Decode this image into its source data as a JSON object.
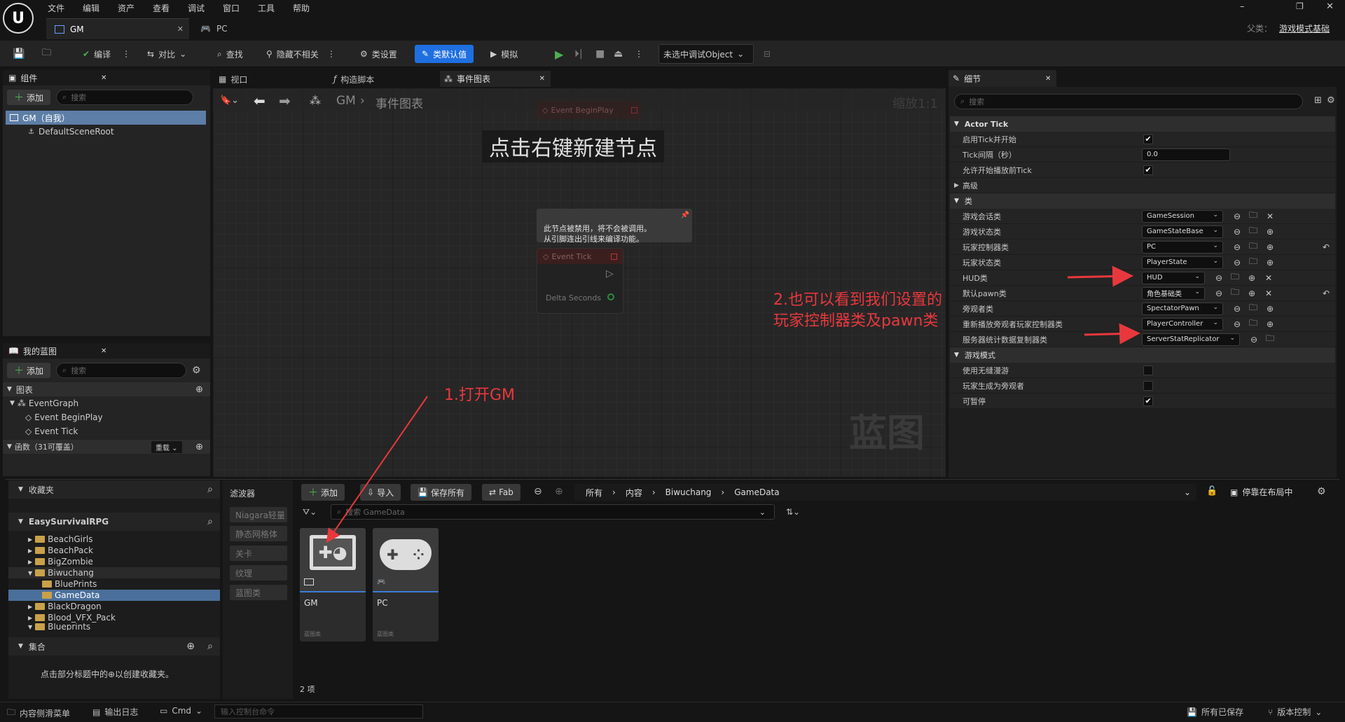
{
  "menu": [
    "文件",
    "编辑",
    "资产",
    "查看",
    "调试",
    "窗口",
    "工具",
    "帮助"
  ],
  "window_controls": {
    "minimize": "–",
    "restore": "❐",
    "close": "✕"
  },
  "tabs": [
    {
      "label": "GM",
      "active": true
    },
    {
      "label": "PC",
      "active": false
    }
  ],
  "parent_class": {
    "label": "父类：",
    "value": "游戏模式基础"
  },
  "toolbar": {
    "compile": "编译",
    "diff": "对比",
    "find": "查找",
    "hide_unrelated": "隐藏不相关",
    "class_settings": "类设置",
    "class_defaults": "类默认值",
    "simulate": "模拟",
    "debug_object": "未选中调试Object"
  },
  "components": {
    "title": "组件",
    "add": "添加",
    "search_placeholder": "搜索",
    "items": [
      {
        "label": "GM（自我）"
      },
      {
        "label": "DefaultSceneRoot"
      }
    ]
  },
  "my_blueprint": {
    "title": "我的蓝图",
    "add": "添加",
    "search_placeholder": "搜索",
    "graphs_label": "图表",
    "event_graph": "EventGraph",
    "events": [
      "Event BeginPlay",
      "Event Tick"
    ],
    "functions_label": "函数（31可覆盖）",
    "override": "重载"
  },
  "graph_tabs": [
    {
      "label": "视口"
    },
    {
      "label": "构造脚本"
    },
    {
      "label": "事件图表"
    }
  ],
  "graph": {
    "breadcrumb_root": "GM",
    "breadcrumb_leaf": "事件图表",
    "zoom": "缩放1:1",
    "hint": "点击右键新建节点",
    "disabled_note": "此节点被禁用，将不会被调用。\n从引脚连出引线来编译功能。",
    "begin_play_node": "Event BeginPlay",
    "tick_node": "Event Tick",
    "tick_pin": "Delta Seconds",
    "watermark": "蓝图"
  },
  "details": {
    "title": "细节",
    "search_placeholder": "搜索",
    "actor_tick": "Actor Tick",
    "tick_rows": [
      {
        "label": "启用Tick并开始",
        "checked": true
      },
      {
        "label": "Tick间隔（秒）",
        "value": "0.0"
      },
      {
        "label": "允许开始播放前Tick",
        "checked": true
      }
    ],
    "advanced": "高级",
    "class_cat": "类",
    "class_rows": [
      {
        "label": "游戏会话类",
        "value": "GameSession"
      },
      {
        "label": "游戏状态类",
        "value": "GameStateBase"
      },
      {
        "label": "玩家控制器类",
        "value": "PC"
      },
      {
        "label": "玩家状态类",
        "value": "PlayerState"
      },
      {
        "label": "HUD类",
        "value": "HUD"
      },
      {
        "label": "默认pawn类",
        "value": "角色基础类"
      },
      {
        "label": "旁观者类",
        "value": "SpectatorPawn"
      },
      {
        "label": "重新播放旁观者玩家控制器类",
        "value": "PlayerController"
      },
      {
        "label": "服务器统计数据复制器类",
        "value": "ServerStatReplicator"
      }
    ],
    "game_mode_cat": "游戏模式",
    "game_mode_rows": [
      {
        "label": "使用无缝漫游",
        "checked": false
      },
      {
        "label": "玩家生成为旁观者",
        "checked": false
      },
      {
        "label": "可暂停",
        "checked": true
      }
    ]
  },
  "content_browser": {
    "favorites": "收藏夹",
    "project": "EasySurvivalRPG",
    "folders": [
      "BeachGirls",
      "BeachPack",
      "BigZombie",
      "Biwuchang",
      "BluePrints",
      "GameData",
      "BlackDragon",
      "Blood_VFX_Pack",
      "Blueprints"
    ],
    "collections": "集合",
    "collections_hint": "点击部分标题中的⊕以创建收藏夹。",
    "filters_label": "滤波器",
    "filters": [
      "Niagara轻量",
      "静态网格体",
      "关卡",
      "纹理",
      "蓝图类"
    ],
    "add": "添加",
    "import": "导入",
    "save_all": "保存所有",
    "fab": "Fab",
    "path": [
      "所有",
      "内容",
      "Biwuchang",
      "GameData"
    ],
    "dock": "停靠在布局中",
    "search_placeholder": "搜索 GameData",
    "assets": [
      {
        "name": "GM",
        "type": "蓝图类"
      },
      {
        "name": "PC",
        "type": "蓝图类"
      }
    ],
    "count": "2 项"
  },
  "statusbar": {
    "content_drawer": "内容侧滑菜单",
    "output_log": "输出日志",
    "cmd": "Cmd",
    "console_placeholder": "输入控制台命令",
    "all_saved": "所有已保存",
    "source_control": "版本控制"
  },
  "annotations": {
    "step1": "1.打开GM",
    "step2_line1": "2.也可以看到我们设置的",
    "step2_line2": "玩家控制器类及pawn类"
  },
  "colors": {
    "accent": "#1f6fe0",
    "annotation": "#e8383d",
    "play": "#4caf50"
  }
}
